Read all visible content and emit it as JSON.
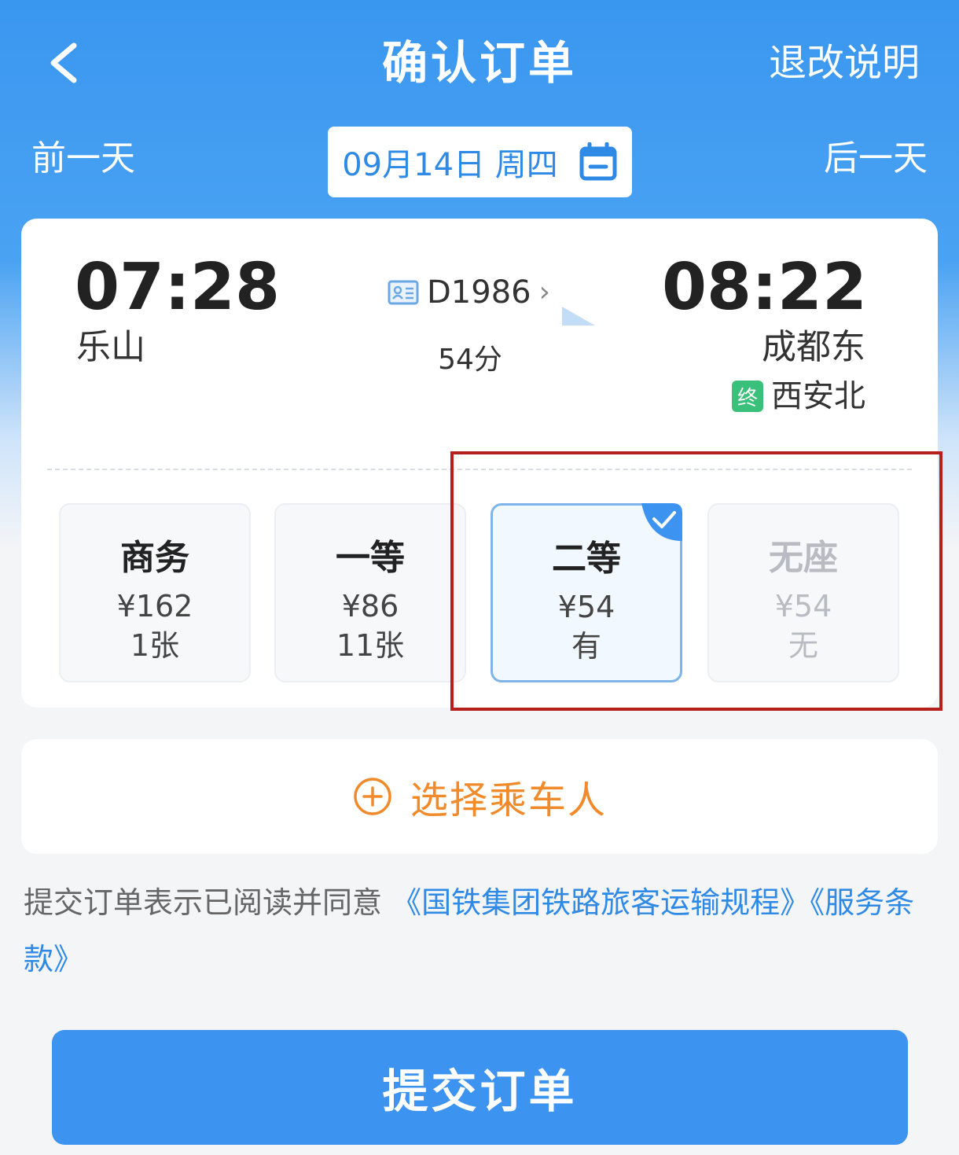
{
  "header": {
    "title": "确认订单",
    "refund_label": "退改说明",
    "back_icon": "chevron-left-icon"
  },
  "date_bar": {
    "prev_label": "前一天",
    "next_label": "后一天",
    "date": "09月14日 周四",
    "calendar_icon": "calendar-icon"
  },
  "train": {
    "departure_time": "07:28",
    "departure_station": "乐山",
    "arrival_time": "08:22",
    "arrival_station": "成都东",
    "train_number": "D1986",
    "duration": "54分",
    "terminal_badge": "终",
    "terminal_station": "西安北"
  },
  "seats": [
    {
      "name": "商务",
      "price": "¥162",
      "availability": "1张",
      "state": "normal"
    },
    {
      "name": "一等",
      "price": "¥86",
      "availability": "11张",
      "state": "normal"
    },
    {
      "name": "二等",
      "price": "¥54",
      "availability": "有",
      "state": "selected"
    },
    {
      "name": "无座",
      "price": "¥54",
      "availability": "无",
      "state": "disabled"
    }
  ],
  "passenger": {
    "label": "选择乘车人",
    "icon": "plus-circle-icon"
  },
  "agreement": {
    "prefix": "提交订单表示已阅读并同意 ",
    "link1": "《国铁集团铁路旅客运输规程》",
    "link2": "《服务条款》"
  },
  "submit_label": "提交订单",
  "colors": {
    "brand_blue": "#3d93f0",
    "link_blue": "#2f8ae6",
    "accent_orange": "#f08a2a",
    "terminal_green": "#39c07a",
    "highlight_red": "#b5201c"
  }
}
